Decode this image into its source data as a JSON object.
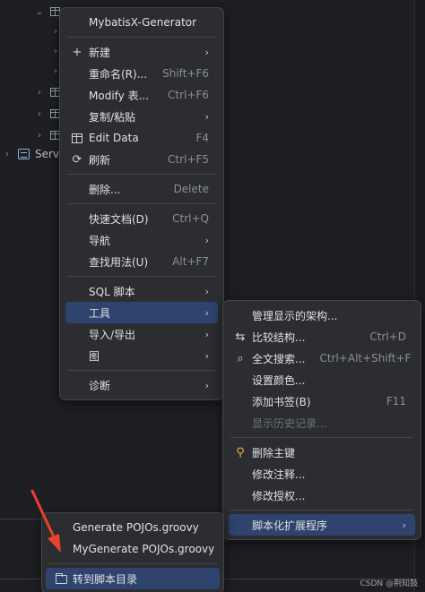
{
  "tree": {
    "server_label": "Serv"
  },
  "context_menu": {
    "title": "MybatisX-Generator",
    "items": {
      "new": {
        "label": "新建"
      },
      "rename": {
        "label": "重命名(R)...",
        "shortcut": "Shift+F6"
      },
      "modify": {
        "label": "Modify 表...",
        "shortcut": "Ctrl+F6"
      },
      "copy_paste": {
        "label": "复制/粘贴"
      },
      "edit_data": {
        "label": "Edit Data",
        "shortcut": "F4"
      },
      "refresh": {
        "label": "刷新",
        "shortcut": "Ctrl+F5"
      },
      "delete": {
        "label": "删除...",
        "shortcut": "Delete"
      },
      "quick_doc": {
        "label": "快速文档(D)",
        "shortcut": "Ctrl+Q"
      },
      "navigate": {
        "label": "导航"
      },
      "find_usages": {
        "label": "查找用法(U)",
        "shortcut": "Alt+F7"
      },
      "sql_script": {
        "label": "SQL 脚本"
      },
      "tools": {
        "label": "工具"
      },
      "import_export": {
        "label": "导入/导出"
      },
      "diagram": {
        "label": "图"
      },
      "diagnose": {
        "label": "诊断"
      }
    }
  },
  "tools_menu": {
    "items": {
      "manage_schema": {
        "label": "管理显示的架构..."
      },
      "compare": {
        "label": "比较结构...",
        "shortcut": "Ctrl+D"
      },
      "full_text": {
        "label": "全文搜索...",
        "shortcut": "Ctrl+Alt+Shift+F"
      },
      "set_color": {
        "label": "设置颜色..."
      },
      "bookmark": {
        "label": "添加书签(B)",
        "shortcut": "F11"
      },
      "history": {
        "label": "显示历史记录..."
      },
      "delete_pk": {
        "label": "删除主键"
      },
      "modify_comment": {
        "label": "修改注释..."
      },
      "modify_grant": {
        "label": "修改授权..."
      },
      "scripted_ext": {
        "label": "脚本化扩展程序"
      }
    }
  },
  "scripts_menu": {
    "items": {
      "generate_pojos": {
        "label": "Generate POJOs.groovy"
      },
      "my_generate_pojos": {
        "label": "MyGenerate POJOs.groovy"
      },
      "goto_scripts": {
        "label": "转到脚本目录"
      }
    }
  },
  "watermark": "CSDN @荆知鼓",
  "colors": {
    "background": "#1e1f22",
    "menu_bg": "#2b2d30",
    "selection": "#2e436e",
    "annotation_arrow": "#e8412c"
  }
}
